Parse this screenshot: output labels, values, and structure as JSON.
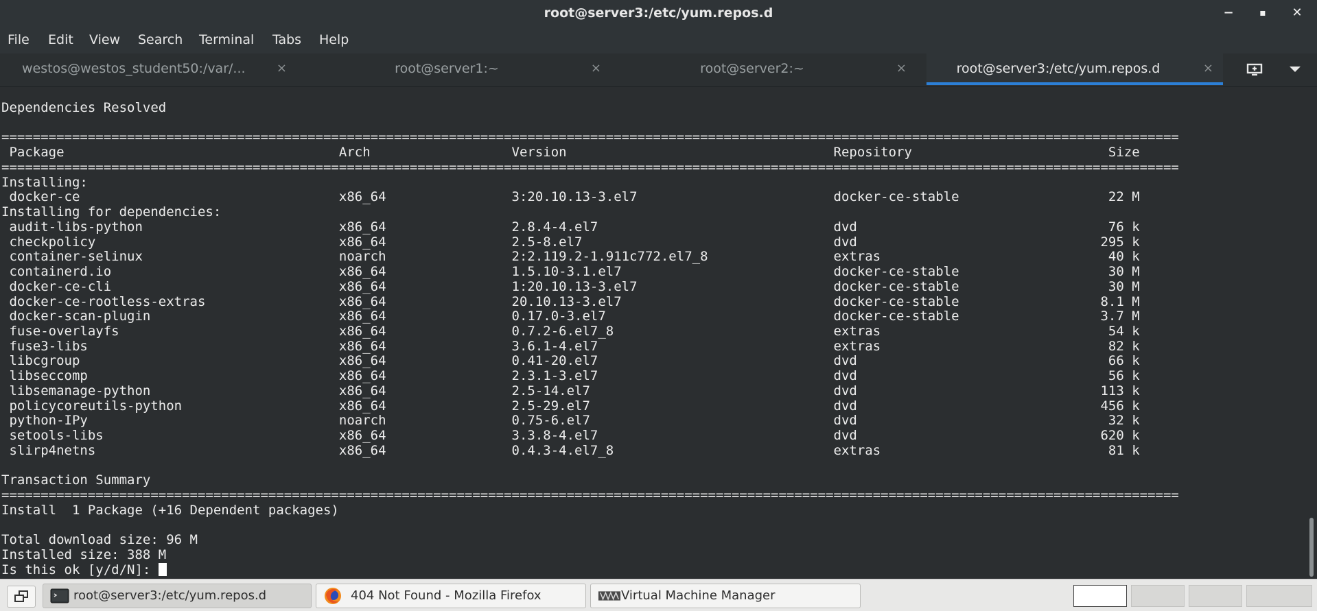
{
  "window": {
    "title": "root@server3:/etc/yum.repos.d",
    "minimize": "−",
    "maximize": "▪",
    "close": "✕"
  },
  "menu": [
    "File",
    "Edit",
    "View",
    "Search",
    "Terminal",
    "Tabs",
    "Help"
  ],
  "tabs": [
    {
      "label": "westos@westos_student50:/var/...",
      "active": false
    },
    {
      "label": "root@server1:~",
      "active": false
    },
    {
      "label": "root@server2:~",
      "active": false
    },
    {
      "label": "root@server3:/etc/yum.repos.d",
      "active": true
    }
  ],
  "tab_close": "×",
  "terminal": {
    "pre": "Dependencies Resolved\n\n======================================================================================================================================================\n Package                                   Arch                  Version                                  Repository                         Size\n======================================================================================================================================================\nInstalling:\n docker-ce                                 x86_64                3:20.10.13-3.el7                         docker-ce-stable                   22 M\nInstalling for dependencies:\n audit-libs-python                         x86_64                2.8.4-4.el7                              dvd                                76 k\n checkpolicy                               x86_64                2.5-8.el7                                dvd                               295 k\n container-selinux                         noarch                2:2.119.2-1.911c772.el7_8                extras                             40 k\n containerd.io                             x86_64                1.5.10-3.1.el7                           docker-ce-stable                   30 M\n docker-ce-cli                             x86_64                1:20.10.13-3.el7                         docker-ce-stable                   30 M\n docker-ce-rootless-extras                 x86_64                20.10.13-3.el7                           docker-ce-stable                  8.1 M\n docker-scan-plugin                        x86_64                0.17.0-3.el7                             docker-ce-stable                  3.7 M\n fuse-overlayfs                            x86_64                0.7.2-6.el7_8                            extras                             54 k\n fuse3-libs                                x86_64                3.6.1-4.el7                              extras                             82 k\n libcgroup                                 x86_64                0.41-20.el7                              dvd                                66 k\n libseccomp                                x86_64                2.3.1-3.el7                              dvd                                56 k\n libsemanage-python                        x86_64                2.5-14.el7                               dvd                               113 k\n policycoreutils-python                    x86_64                2.5-29.el7                               dvd                               456 k\n python-IPy                                noarch                0.75-6.el7                               dvd                                32 k\n setools-libs                              x86_64                3.3.8-4.el7                              dvd                               620 k\n slirp4netns                               x86_64                0.4.3-4.el7_8                            extras                             81 k\n\nTransaction Summary\n======================================================================================================================================================\nInstall  1 Package (+16 Dependent packages)\n\nTotal download size: 96 M\nInstalled size: 388 M\n",
    "prompt": "Is this ok [y/d/N]: "
  },
  "taskbar": {
    "items": [
      {
        "label": "root@server3:/etc/yum.repos.d",
        "icon": "terminal-icon",
        "active": true
      },
      {
        "label": "404 Not Found - Mozilla Firefox",
        "icon": "firefox-icon",
        "active": false
      },
      {
        "label": "Virtual Machine Manager",
        "icon": "virt-manager-icon",
        "active": false
      }
    ],
    "workspaces": 4,
    "active_workspace": 1
  },
  "colors": {
    "terminal_bg": "#2b2e30",
    "terminal_fg": "#ececec",
    "active_tab_accent": "#2c7fd6",
    "taskbar_bg": "#e8e8e7"
  }
}
